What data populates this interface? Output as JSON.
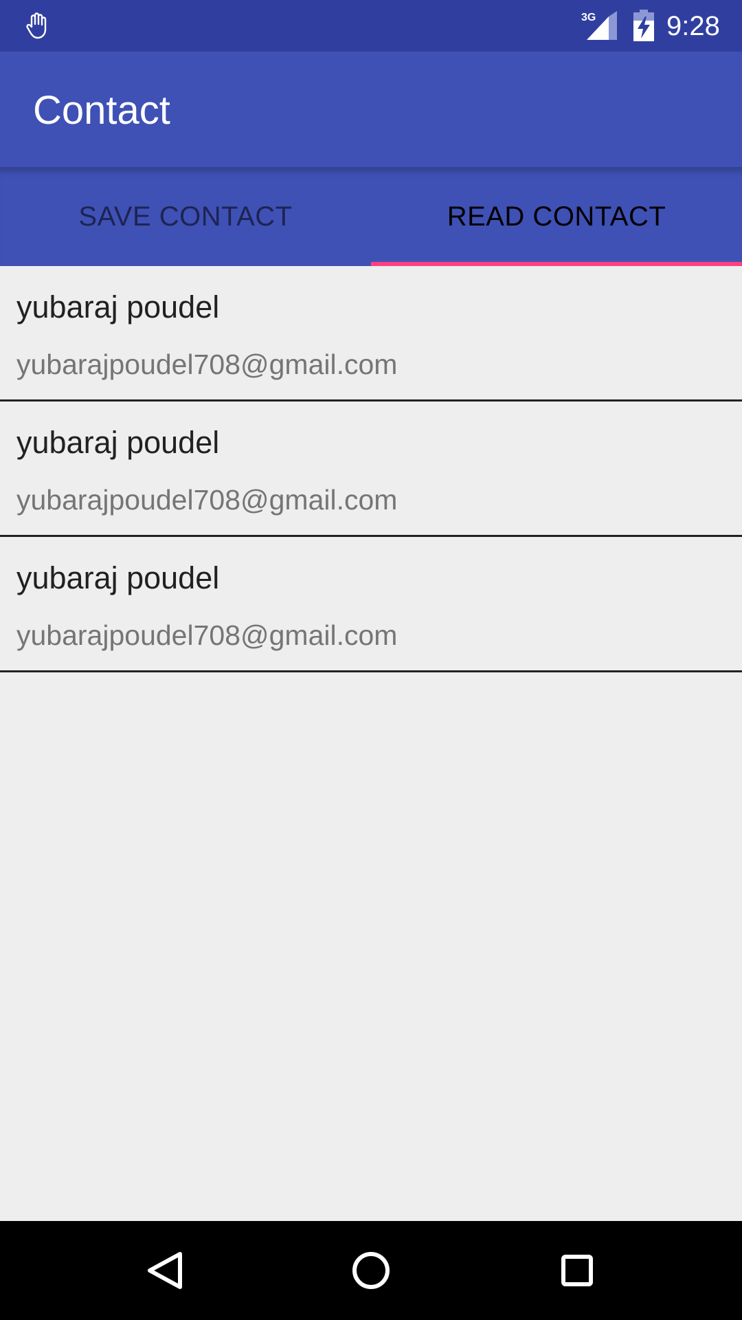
{
  "status_bar": {
    "time": "9:28",
    "network": "3G",
    "icons": [
      "hand-icon",
      "signal-icon",
      "battery-charging-icon"
    ]
  },
  "app_bar": {
    "title": "Contact"
  },
  "tabs": [
    {
      "label": "SAVE CONTACT",
      "selected": false
    },
    {
      "label": "READ CONTACT",
      "selected": true
    }
  ],
  "contacts": [
    {
      "name": "yubaraj poudel",
      "email": "yubarajpoudel708@gmail.com"
    },
    {
      "name": "yubaraj poudel",
      "email": "yubarajpoudel708@gmail.com"
    },
    {
      "name": "yubaraj poudel",
      "email": "yubarajpoudel708@gmail.com"
    }
  ],
  "nav_bar": {
    "icons": [
      "back-icon",
      "home-icon",
      "recents-icon"
    ]
  },
  "colors": {
    "status_bar": "#303f9f",
    "primary": "#3f51b5",
    "accent": "#ff4081",
    "background": "#eeeeee",
    "nav_bar": "#000000"
  }
}
